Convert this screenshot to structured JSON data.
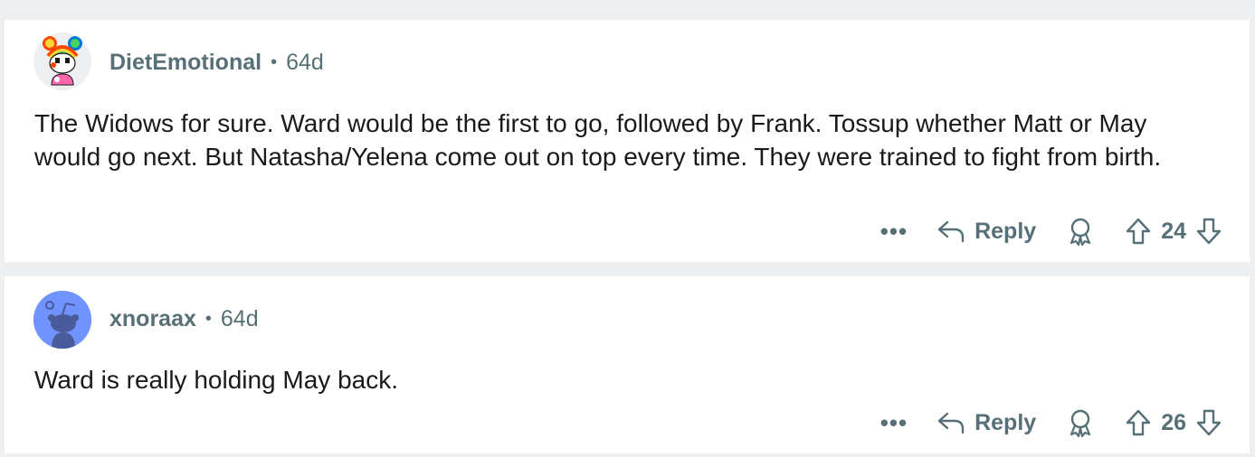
{
  "comments": [
    {
      "username": "DietEmotional",
      "separator": "•",
      "age": "64d",
      "text": "The Widows for sure. Ward would be the first to go, followed by Frank. Tossup whether Matt or May would go next. But Natasha/Yelena come out on top every time. They were trained to fight from birth.",
      "more_label": "•••",
      "reply_label": "Reply",
      "score": "24"
    },
    {
      "username": "xnoraax",
      "separator": "•",
      "age": "64d",
      "text": "Ward is really holding May back.",
      "more_label": "•••",
      "reply_label": "Reply",
      "score": "26"
    }
  ],
  "icons": {
    "reply": "reply-arrow-icon",
    "award": "award-icon",
    "upvote": "upvote-arrow-icon",
    "downvote": "downvote-arrow-icon"
  },
  "colors": {
    "background": "#edeff1",
    "card": "#ffffff",
    "meta_text": "#576f76",
    "body_text": "#1a1a1b",
    "snoo_blue": "#7193ff"
  }
}
